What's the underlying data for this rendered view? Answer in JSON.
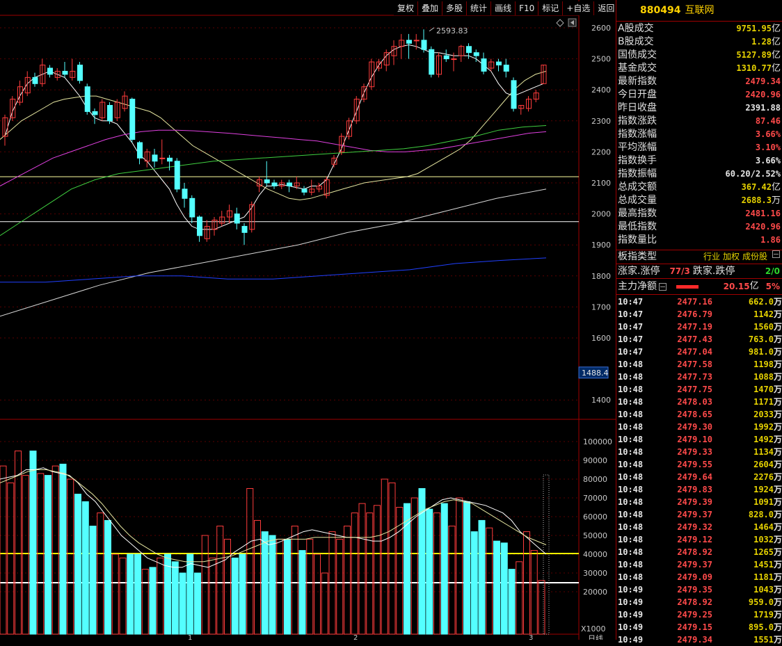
{
  "toolbar": {
    "buttons": [
      "复权",
      "叠加",
      "多股",
      "统计",
      "画线",
      "F10",
      "标记",
      "+自选",
      "返回"
    ]
  },
  "chart": {
    "price_axis": [
      "2600",
      "2500",
      "2400",
      "2300",
      "2200",
      "2100",
      "2000",
      "1900",
      "1800",
      "1700",
      "1600",
      "1400"
    ],
    "current_label": "1488.4",
    "high_annotation": "2593.83",
    "volume_axis": [
      "100000",
      "90000",
      "80000",
      "70000",
      "60000",
      "50000",
      "40000",
      "30000",
      "20000"
    ],
    "volume_unit": "X1000",
    "date_markers": [
      "1",
      "2",
      "3"
    ],
    "bottom_label": "日线"
  },
  "chart_data": {
    "type": "candlestick",
    "high_label": 2593.83,
    "candles": [
      [
        2250,
        2310,
        2220,
        2320
      ],
      [
        2310,
        2370,
        2300,
        2380
      ],
      [
        2360,
        2410,
        2350,
        2430
      ],
      [
        2390,
        2440,
        2380,
        2460
      ],
      [
        2440,
        2420,
        2410,
        2455
      ],
      [
        2420,
        2480,
        2410,
        2500
      ],
      [
        2470,
        2450,
        2440,
        2480
      ],
      [
        2440,
        2460,
        2430,
        2470
      ],
      [
        2460,
        2450,
        2440,
        2490
      ],
      [
        2440,
        2460,
        2430,
        2500
      ],
      [
        2480,
        2430,
        2420,
        2490
      ],
      [
        2410,
        2330,
        2320,
        2420
      ],
      [
        2330,
        2320,
        2290,
        2340
      ],
      [
        2310,
        2360,
        2300,
        2370
      ],
      [
        2350,
        2300,
        2290,
        2360
      ],
      [
        2310,
        2360,
        2300,
        2370
      ],
      [
        2340,
        2380,
        2330,
        2395
      ],
      [
        2370,
        2240,
        2230,
        2375
      ],
      [
        2230,
        2180,
        2160,
        2235
      ],
      [
        2170,
        2200,
        2150,
        2210
      ],
      [
        2190,
        2170,
        2150,
        2210
      ],
      [
        2180,
        2180,
        2160,
        2240
      ],
      [
        2180,
        2170,
        2140,
        2190
      ],
      [
        2170,
        2080,
        2070,
        2180
      ],
      [
        2080,
        2050,
        2020,
        2100
      ],
      [
        2050,
        1990,
        1970,
        2060
      ],
      [
        1990,
        1930,
        1910,
        1995
      ],
      [
        1920,
        1960,
        1910,
        1980
      ],
      [
        1950,
        1980,
        1930,
        1990
      ],
      [
        1970,
        1990,
        1960,
        2010
      ],
      [
        1990,
        2010,
        1970,
        2030
      ],
      [
        2000,
        1970,
        1950,
        2020
      ],
      [
        1960,
        1940,
        1900,
        1970
      ],
      [
        1950,
        2030,
        1940,
        2040
      ],
      [
        2090,
        2110,
        2070,
        2120
      ],
      [
        2110,
        2100,
        2090,
        2170
      ],
      [
        2100,
        2090,
        2080,
        2110
      ],
      [
        2090,
        2100,
        2080,
        2110
      ],
      [
        2100,
        2090,
        2070,
        2110
      ],
      [
        2090,
        2100,
        2080,
        2120
      ],
      [
        2080,
        2070,
        2060,
        2090
      ],
      [
        2070,
        2080,
        2060,
        2110
      ],
      [
        2080,
        2090,
        2070,
        2100
      ],
      [
        2060,
        2110,
        2050,
        2120
      ],
      [
        2160,
        2180,
        2150,
        2190
      ],
      [
        2200,
        2250,
        2190,
        2260
      ],
      [
        2250,
        2300,
        2240,
        2310
      ],
      [
        2300,
        2370,
        2290,
        2380
      ],
      [
        2370,
        2410,
        2360,
        2420
      ],
      [
        2410,
        2490,
        2400,
        2500
      ],
      [
        2470,
        2490,
        2460,
        2500
      ],
      [
        2480,
        2520,
        2460,
        2530
      ],
      [
        2510,
        2540,
        2480,
        2560
      ],
      [
        2540,
        2560,
        2500,
        2580
      ],
      [
        2560,
        2550,
        2500,
        2580
      ],
      [
        2560,
        2560,
        2530,
        2580
      ],
      [
        2560,
        2530,
        2520,
        2595
      ],
      [
        2530,
        2450,
        2440,
        2540
      ],
      [
        2450,
        2510,
        2440,
        2520
      ],
      [
        2510,
        2500,
        2490,
        2530
      ],
      [
        2500,
        2500,
        2460,
        2520
      ],
      [
        2510,
        2540,
        2490,
        2545
      ],
      [
        2540,
        2520,
        2500,
        2550
      ],
      [
        2520,
        2510,
        2490,
        2530
      ],
      [
        2500,
        2460,
        2450,
        2520
      ],
      [
        2470,
        2490,
        2460,
        2500
      ],
      [
        2490,
        2480,
        2460,
        2500
      ],
      [
        2480,
        2460,
        2440,
        2500
      ],
      [
        2430,
        2340,
        2330,
        2440
      ],
      [
        2340,
        2350,
        2320,
        2350
      ],
      [
        2340,
        2370,
        2330,
        2380
      ],
      [
        2370,
        2390,
        2360,
        2400
      ],
      [
        2420,
        2480,
        2420,
        2481
      ]
    ],
    "ma_lines": {
      "ma5_white": [
        [
          2250,
          2330,
          2380,
          2420,
          2440,
          2450,
          2460,
          2450,
          2440,
          2410,
          2380,
          2340,
          2310,
          2300,
          2300,
          2290,
          2260,
          2230,
          2190,
          2170,
          2140,
          2110,
          2080,
          2030,
          1990,
          1960,
          1950,
          1950,
          1950,
          1960,
          1970,
          1980,
          1990,
          2020,
          2060,
          2090,
          2090,
          2095,
          2090,
          2085,
          2080,
          2090,
          2090,
          2110,
          2160,
          2210,
          2270,
          2330,
          2390,
          2440,
          2480,
          2510,
          2530,
          2540,
          2545,
          2540,
          2530,
          2520,
          2520,
          2515,
          2510,
          2510,
          2510,
          2500,
          2480,
          2460,
          2420,
          2390,
          2380,
          2390,
          2400,
          2410,
          2420
        ]
      ],
      "ma10_yellow": [
        [
          2240,
          2270,
          2300,
          2320,
          2340,
          2360,
          2370,
          2375,
          2380,
          2380,
          2370,
          2360,
          2350,
          2340,
          2330,
          2310,
          2280,
          2250,
          2220,
          2200,
          2180,
          2160,
          2140,
          2120,
          2100,
          2080,
          2065,
          2050,
          2045,
          2050,
          2060,
          2070,
          2080,
          2090,
          2100,
          2105,
          2110,
          2115,
          2120,
          2130,
          2150,
          2170,
          2190,
          2210,
          2240,
          2280,
          2320,
          2360,
          2400,
          2430,
          2450,
          2460
        ]
      ],
      "ma20_magenta": [
        [
          2090,
          2120,
          2150,
          2180,
          2200,
          2220,
          2240,
          2255,
          2265,
          2270,
          2270,
          2268,
          2264,
          2260,
          2255,
          2250,
          2245,
          2240,
          2235,
          2225,
          2215,
          2205,
          2200,
          2200,
          2205,
          2210,
          2220,
          2230,
          2240,
          2250,
          2260,
          2265
        ]
      ],
      "ma30_green": [
        [
          1930,
          1980,
          2030,
          2080,
          2110,
          2130,
          2140,
          2150,
          2160,
          2170,
          2175,
          2180,
          2185,
          2190,
          2195,
          2200,
          2205,
          2210,
          2220,
          2235,
          2250,
          2270,
          2280,
          2285
        ]
      ],
      "ma60_white": [
        [
          1670,
          1720,
          1770,
          1810,
          1840,
          1870,
          1900,
          1940,
          1970,
          2010,
          2050,
          2080
        ]
      ],
      "ma120_blue": [
        [
          1780,
          1780,
          1790,
          1800,
          1800,
          1790,
          1790,
          1800,
          1810,
          1820,
          1840,
          1850,
          1858
        ]
      ]
    },
    "horizontal_lines": [
      2120,
      1975
    ],
    "volume": [
      87,
      78,
      95,
      82,
      95,
      83,
      82,
      87,
      88,
      80,
      72,
      68,
      55,
      62,
      58,
      40,
      38,
      40,
      40,
      32,
      33,
      38,
      40,
      36,
      30,
      40,
      30,
      50,
      38,
      55,
      48,
      38,
      40,
      75,
      58,
      52,
      50,
      48,
      48,
      55,
      42,
      48,
      40,
      30,
      52,
      48,
      55,
      62,
      67,
      62,
      66,
      80,
      78,
      65,
      67,
      70,
      75,
      64,
      62,
      67,
      55,
      70,
      68,
      52,
      58,
      54,
      47,
      46,
      32,
      36,
      52,
      42,
      26
    ],
    "volume_ma5": [
      80,
      81,
      82,
      85,
      85,
      86,
      84,
      83,
      82,
      78,
      72,
      68,
      62,
      56,
      50,
      46,
      42,
      38,
      36,
      34,
      33,
      33,
      35,
      34,
      33,
      35,
      37,
      41,
      44,
      47,
      48,
      45,
      46,
      48,
      50,
      52,
      53,
      52,
      51,
      50,
      49,
      49,
      48,
      47,
      47,
      49,
      52,
      56,
      60,
      63,
      66,
      69,
      70,
      69,
      68,
      67,
      66,
      64,
      62,
      58,
      52,
      48,
      44,
      40
    ],
    "volume_ma10": [
      78,
      80,
      82,
      84,
      85,
      85,
      84,
      83,
      80,
      76,
      72,
      67,
      61,
      55,
      50,
      46,
      43,
      40,
      38,
      37,
      36,
      36,
      36,
      37,
      38,
      39,
      41,
      43,
      45,
      47,
      48,
      48,
      48,
      48,
      49,
      49,
      49,
      49,
      49,
      49,
      49,
      50,
      52,
      55,
      58,
      61,
      64,
      66,
      68,
      69,
      68,
      67,
      64,
      61,
      58,
      55,
      52,
      49,
      47,
      45
    ]
  },
  "side": {
    "code": "880494",
    "name": "互联网",
    "stats": [
      {
        "label": "A股成交",
        "value": "9751.95",
        "unit": "亿",
        "color": "yellow"
      },
      {
        "label": "B股成交",
        "value": "1.28",
        "unit": "亿",
        "color": "yellow"
      },
      {
        "label": "国债成交",
        "value": "5127.89",
        "unit": "亿",
        "color": "yellow"
      },
      {
        "label": "基金成交",
        "value": "1310.77",
        "unit": "亿",
        "color": "yellow"
      },
      {
        "label": "最新指数",
        "value": "2479.34",
        "unit": "",
        "color": "red"
      },
      {
        "label": "今日开盘",
        "value": "2420.96",
        "unit": "",
        "color": "red"
      },
      {
        "label": "昨日收盘",
        "value": "2391.88",
        "unit": "",
        "color": "white"
      },
      {
        "label": "指数涨跌",
        "value": "87.46",
        "unit": "",
        "color": "red"
      },
      {
        "label": "指数涨幅",
        "value": "3.66%",
        "unit": "",
        "color": "red"
      },
      {
        "label": "平均涨幅",
        "value": "3.10%",
        "unit": "",
        "color": "red"
      },
      {
        "label": "指数换手",
        "value": "3.66%",
        "unit": "",
        "color": "white"
      },
      {
        "label": "指数振幅",
        "value": "60.20/2.52%",
        "unit": "",
        "color": "white"
      },
      {
        "label": "总成交额",
        "value": "367.42",
        "unit": "亿",
        "color": "yellow"
      },
      {
        "label": "总成交量",
        "value": "2688.3",
        "unit": "万",
        "color": "yellow"
      },
      {
        "label": "最高指数",
        "value": "2481.16",
        "unit": "",
        "color": "red"
      },
      {
        "label": "最低指数",
        "value": "2420.96",
        "unit": "",
        "color": "red"
      },
      {
        "label": "指数量比",
        "value": "1.86",
        "unit": "",
        "color": "red"
      }
    ],
    "sector": {
      "label": "板指类型",
      "tags": [
        "行业",
        "加权",
        "成份股"
      ]
    },
    "limits": {
      "up_label": "涨家.涨停",
      "up_value": "77/3",
      "down_label": "跌家.跌停",
      "down_value": "2/0"
    },
    "flow": {
      "label": "主力净额",
      "value": "20.15",
      "unit": "亿",
      "pct": "5%"
    },
    "ticks": [
      [
        "10:47",
        "2477.16",
        "662.0",
        "万"
      ],
      [
        "10:47",
        "2476.79",
        "1142",
        "万"
      ],
      [
        "10:47",
        "2477.19",
        "1560",
        "万"
      ],
      [
        "10:47",
        "2477.43",
        "763.0",
        "万"
      ],
      [
        "10:47",
        "2477.04",
        "981.0",
        "万"
      ],
      [
        "10:48",
        "2477.58",
        "1198",
        "万"
      ],
      [
        "10:48",
        "2477.73",
        "1088",
        "万"
      ],
      [
        "10:48",
        "2477.75",
        "1470",
        "万"
      ],
      [
        "10:48",
        "2478.03",
        "1171",
        "万"
      ],
      [
        "10:48",
        "2478.65",
        "2033",
        "万"
      ],
      [
        "10:48",
        "2479.30",
        "1992",
        "万"
      ],
      [
        "10:48",
        "2479.10",
        "1492",
        "万"
      ],
      [
        "10:48",
        "2479.33",
        "1134",
        "万"
      ],
      [
        "10:48",
        "2479.55",
        "2604",
        "万"
      ],
      [
        "10:48",
        "2479.64",
        "2276",
        "万"
      ],
      [
        "10:48",
        "2479.83",
        "1924",
        "万"
      ],
      [
        "10:48",
        "2479.39",
        "1091",
        "万"
      ],
      [
        "10:48",
        "2479.37",
        "828.0",
        "万"
      ],
      [
        "10:48",
        "2479.32",
        "1464",
        "万"
      ],
      [
        "10:48",
        "2479.12",
        "1032",
        "万"
      ],
      [
        "10:48",
        "2478.92",
        "1265",
        "万"
      ],
      [
        "10:48",
        "2479.37",
        "1451",
        "万"
      ],
      [
        "10:48",
        "2479.09",
        "1181",
        "万"
      ],
      [
        "10:49",
        "2479.35",
        "1043",
        "万"
      ],
      [
        "10:49",
        "2478.92",
        "959.0",
        "万"
      ],
      [
        "10:49",
        "2479.25",
        "1719",
        "万"
      ],
      [
        "10:49",
        "2479.15",
        "895.0",
        "万"
      ],
      [
        "10:49",
        "2479.34",
        "1551",
        "万"
      ]
    ]
  }
}
